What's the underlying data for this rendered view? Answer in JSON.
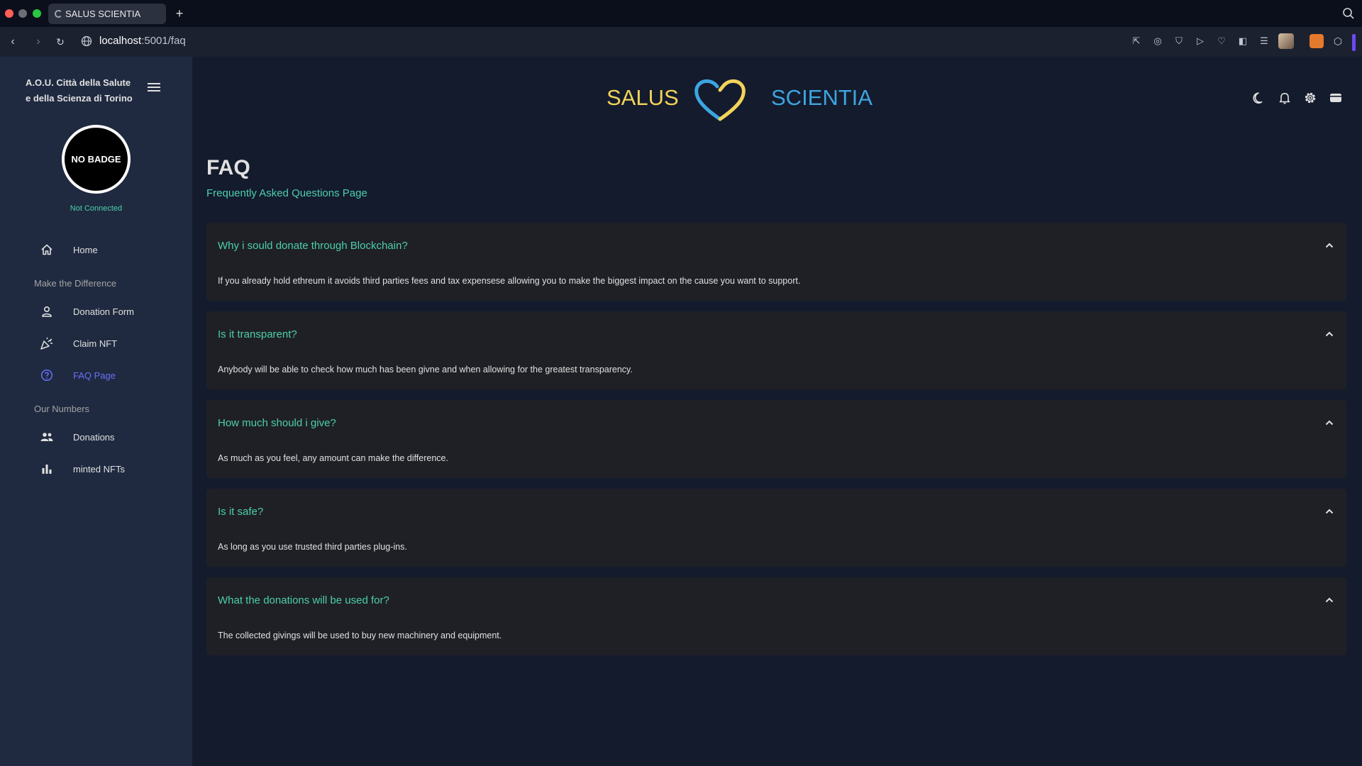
{
  "browser": {
    "tab_title": "SALUS SCIENTIA",
    "new_tab": "+",
    "url_host": "localhost",
    "url_path": ":5001/faq"
  },
  "sidebar": {
    "org_line1": "A.O.U. Città della Salute",
    "org_line2": "e della Scienza di Torino",
    "badge": "NO BADGE",
    "connection_status": "Not Connected",
    "items": [
      {
        "label": "Home",
        "icon": "home-icon"
      },
      {
        "label": "Donation Form",
        "icon": "person-icon"
      },
      {
        "label": "Claim NFT",
        "icon": "celebration-icon"
      },
      {
        "label": "FAQ Page",
        "icon": "help-circle-icon",
        "active": true
      },
      {
        "label": "Donations",
        "icon": "people-icon"
      },
      {
        "label": "minted NFTs",
        "icon": "bar-chart-icon"
      }
    ],
    "sections": [
      "Make the Difference",
      "Our Numbers"
    ]
  },
  "header": {
    "brand_left": "SALUS",
    "brand_right": "SCIENTIA",
    "colors": {
      "gold": "#f2d35a",
      "blue": "#3da5e0"
    }
  },
  "main": {
    "title": "FAQ",
    "subtitle": "Frequently Asked Questions Page",
    "faqs": [
      {
        "q": "Why i sould donate through Blockchain?",
        "a": "If you already hold ethreum it avoids third parties fees and tax expensese allowing you to make the biggest impact on the cause you want to support."
      },
      {
        "q": "Is it transparent?",
        "a": "Anybody will be able to check how much has been givne and when allowing for the greatest transparency."
      },
      {
        "q": "How much should i give?",
        "a": "As much as you feel, any amount can make the difference."
      },
      {
        "q": "Is it safe?",
        "a": "As long as you use trusted third parties plug-ins."
      },
      {
        "q": "What the donations will be used for?",
        "a": "The collected givings will be used to buy new machinery and equipment."
      }
    ]
  },
  "theme": {
    "accent": "#4cceac",
    "active": "#6870fa",
    "bg": "#141b2d",
    "sidebar_bg": "#1f2a40"
  }
}
